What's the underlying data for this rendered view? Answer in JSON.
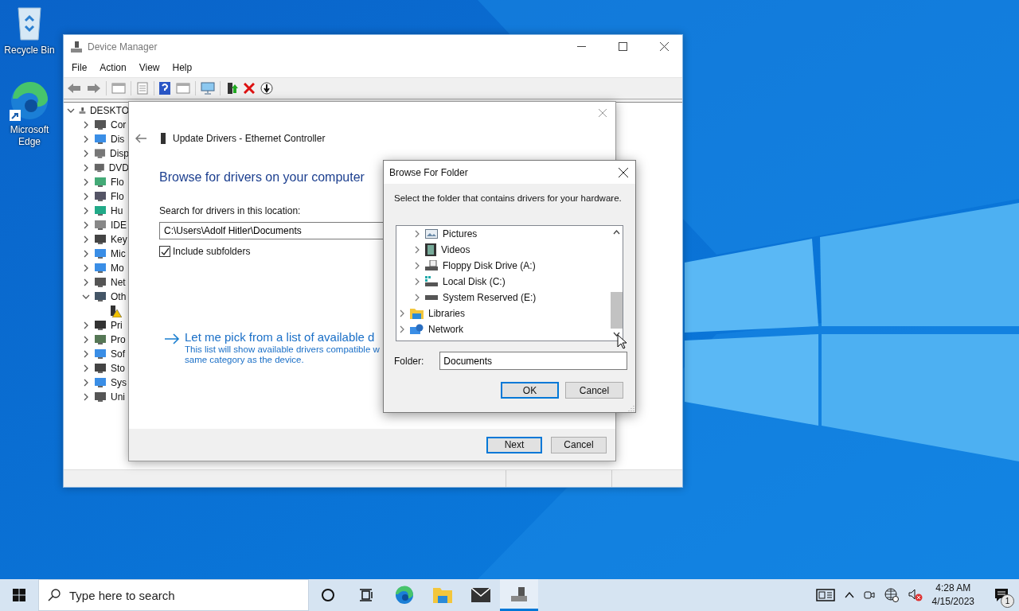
{
  "desktop_icons": [
    {
      "label": "Recycle Bin",
      "kind": "recycle"
    },
    {
      "label": "Microsoft Edge",
      "kind": "edge"
    }
  ],
  "device_manager": {
    "title": "Device Manager",
    "menu": [
      "File",
      "Action",
      "View",
      "Help"
    ],
    "tree": {
      "label": "DESKTO",
      "expanded": true,
      "children": [
        {
          "label": "Cor",
          "expanded": false
        },
        {
          "label": "Dis",
          "expanded": false
        },
        {
          "label": "Disp",
          "expanded": false
        },
        {
          "label": "DVD",
          "expanded": false
        },
        {
          "label": "Flo",
          "expanded": false
        },
        {
          "label": "Flo",
          "expanded": false
        },
        {
          "label": "Hu",
          "expanded": false
        },
        {
          "label": "IDE",
          "expanded": false
        },
        {
          "label": "Key",
          "expanded": false
        },
        {
          "label": "Mic",
          "expanded": false
        },
        {
          "label": "Mo",
          "expanded": false
        },
        {
          "label": "Net",
          "expanded": false
        },
        {
          "label": "Oth",
          "expanded": true,
          "children": [
            {
              "kind": "unknown-device"
            }
          ]
        },
        {
          "label": "Pri",
          "expanded": false
        },
        {
          "label": "Pro",
          "expanded": false
        },
        {
          "label": "Sof",
          "expanded": false
        },
        {
          "label": "Sto",
          "expanded": false
        },
        {
          "label": "Sys",
          "expanded": false
        },
        {
          "label": "Uni",
          "expanded": false
        }
      ]
    }
  },
  "update_dialog": {
    "title": "Update Drivers - Ethernet Controller",
    "heading": "Browse for drivers on your computer",
    "location_label": "Search for drivers in this location:",
    "location_value": "C:\\Users\\Adolf Hitler\\Documents",
    "include_subfolders": {
      "label": "Include subfolders",
      "checked": true
    },
    "link": {
      "title": "Let me pick from a list of available d",
      "description": "This list will show available drivers compatible w",
      "description_2": "same category as the device."
    },
    "buttons": [
      {
        "label": "Next",
        "default": true
      },
      {
        "label": "Cancel",
        "default": false
      }
    ]
  },
  "browse_dialog": {
    "title": "Browse For Folder",
    "instruction": "Select the folder that contains drivers for your hardware.",
    "tree": [
      {
        "children": [
          {
            "label": "Pictures",
            "expanded": false,
            "kind": "pictures"
          },
          {
            "label": "Videos",
            "expanded": false,
            "kind": "videos"
          },
          {
            "label": "Floppy Disk Drive (A:)",
            "expanded": false,
            "kind": "floppy"
          },
          {
            "label": "Local Disk (C:)",
            "expanded": false,
            "kind": "disk-os"
          },
          {
            "label": "System Reserved (E:)",
            "expanded": false,
            "kind": "disk"
          }
        ]
      },
      {
        "label": "Libraries",
        "expanded": false,
        "kind": "libraries"
      },
      {
        "label": "Network",
        "expanded": false,
        "kind": "network"
      }
    ],
    "folder_label": "Folder:",
    "folder_value": "Documents",
    "buttons": [
      {
        "label": "OK",
        "default": true
      },
      {
        "label": "Cancel",
        "default": false
      }
    ]
  },
  "taskbar": {
    "search_placeholder": "Type here to search",
    "apps": [
      {
        "kind": "cortana",
        "active": false
      },
      {
        "kind": "taskview",
        "active": false
      },
      {
        "kind": "edge",
        "active": false
      },
      {
        "kind": "explorer",
        "active": false
      },
      {
        "kind": "mail",
        "active": false
      },
      {
        "kind": "devmgr",
        "active": true
      }
    ],
    "time": "4:28 AM",
    "date": "4/15/2023",
    "notifications": "1"
  }
}
